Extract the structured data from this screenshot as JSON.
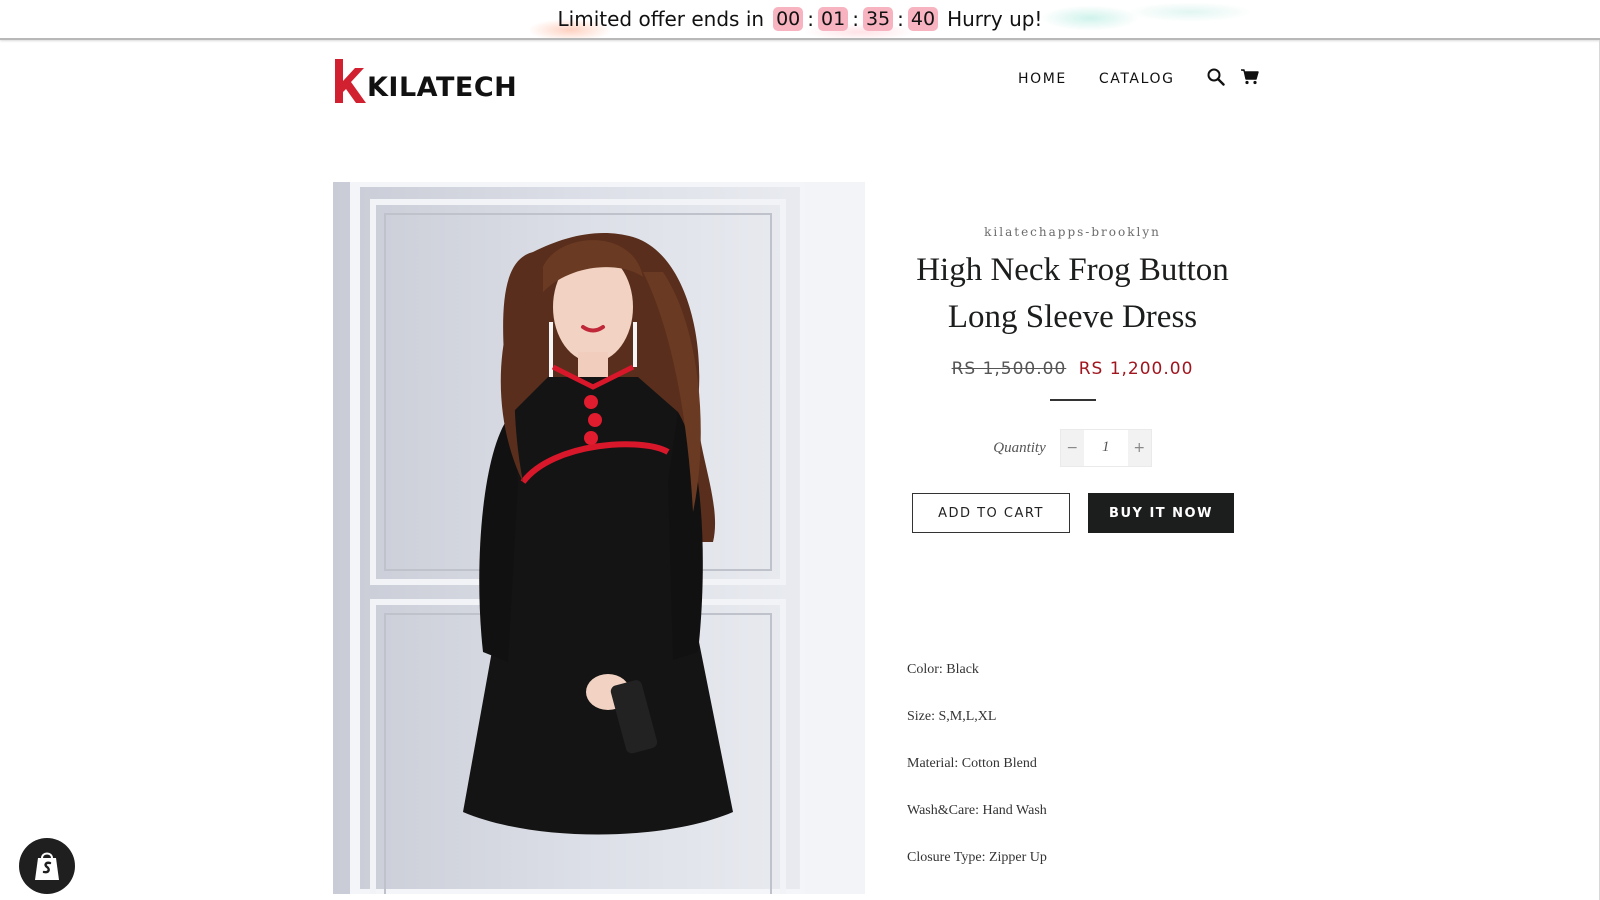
{
  "announcement": {
    "prefix": "Limited offer ends in",
    "hours": "00",
    "minutes": "01",
    "seconds": "35",
    "centis": "40",
    "suffix": "Hurry up!",
    "countdown_color": "#f7b3c0"
  },
  "header": {
    "logo_text": "KILATECH",
    "logo_mark_color": "#d1202f",
    "nav": [
      "HOME",
      "CATALOG"
    ],
    "icons": [
      "search-icon",
      "cart-icon"
    ]
  },
  "product": {
    "vendor": "kilatechapps-brooklyn",
    "title": "High Neck Frog Button Long Sleeve Dress",
    "price_original": "RS 1,500.00",
    "price_sale": "RS 1,200.00",
    "sale_color": "#a0161f",
    "quantity_label": "Quantity",
    "quantity_value": "1",
    "decrement_symbol": "−",
    "increment_symbol": "+",
    "add_to_cart": "ADD TO CART",
    "buy_now": "BUY IT NOW",
    "specs": [
      "Color: Black",
      "Size: S,M,L,XL",
      "Material: Cotton Blend",
      "Wash&Care: Hand Wash",
      "Closure Type: Zipper Up"
    ]
  },
  "shopify_badge_icon": "shopify-bag-icon"
}
